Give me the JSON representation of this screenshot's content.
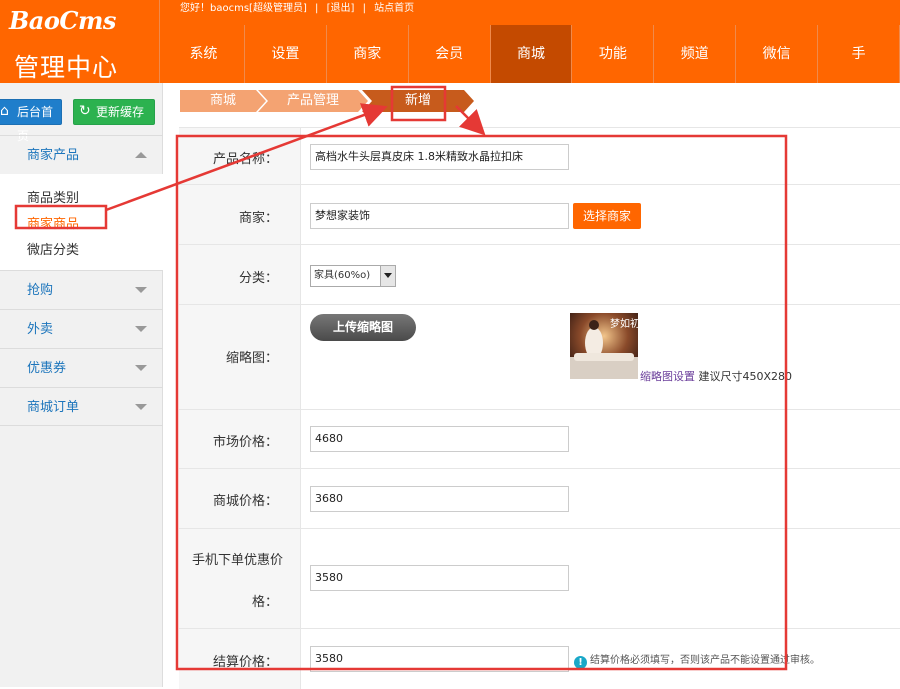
{
  "brand": {
    "logo": "BaoCms",
    "subtitle": "管理中心"
  },
  "topbar": {
    "greeting": "您好！baocms[超级管理员]",
    "sep": "|",
    "logout": "[退出]",
    "site_home": "站点首页"
  },
  "nav": {
    "items": [
      "系统",
      "设置",
      "商家",
      "会员",
      "商城",
      "功能",
      "频道",
      "微信",
      "手"
    ],
    "active_index": 4
  },
  "sidebar": {
    "home_button": "后台首页",
    "refresh_button": "更新缓存",
    "groups": [
      {
        "label": "商家产品",
        "expanded": true,
        "items": [
          "商品类别",
          "商家商品",
          "微店分类"
        ],
        "current_index": 1
      },
      {
        "label": "抢购"
      },
      {
        "label": "外卖"
      },
      {
        "label": "优惠券"
      },
      {
        "label": "商城订单"
      }
    ]
  },
  "breadcrumb": [
    "商城",
    "产品管理",
    "新增"
  ],
  "form": {
    "name": {
      "label": "产品名称：",
      "value": "高档水牛头层真皮床 1.8米精致水晶拉扣床"
    },
    "shop": {
      "label": "商家：",
      "value": "梦想家装饰",
      "button": "选择商家"
    },
    "category": {
      "label": "分类：",
      "selected": "家具(60%o)"
    },
    "thumbnail": {
      "label": "缩略图：",
      "upload_button": "上传缩略图",
      "settings_link": "缩略图设置",
      "size_hint": "建议尺寸450X280",
      "image_text": "梦如初"
    },
    "market_price": {
      "label": "市场价格：",
      "value": "4680"
    },
    "mall_price": {
      "label": "商城价格：",
      "value": "3680"
    },
    "mobile_price": {
      "label_line1": "手机下单优惠价",
      "label_line2": "格：",
      "value": "3580"
    },
    "settle_price": {
      "label": "结算价格：",
      "value": "3580",
      "tip": "结算价格必须填写，否则该产品不能设置通过审核。"
    }
  },
  "colors": {
    "header": "#ff6600",
    "nav_active": "#c44a00",
    "breadcrumb": "#f4a372",
    "breadcrumb_active": "#c75b1c",
    "annotation": "#e53935"
  }
}
